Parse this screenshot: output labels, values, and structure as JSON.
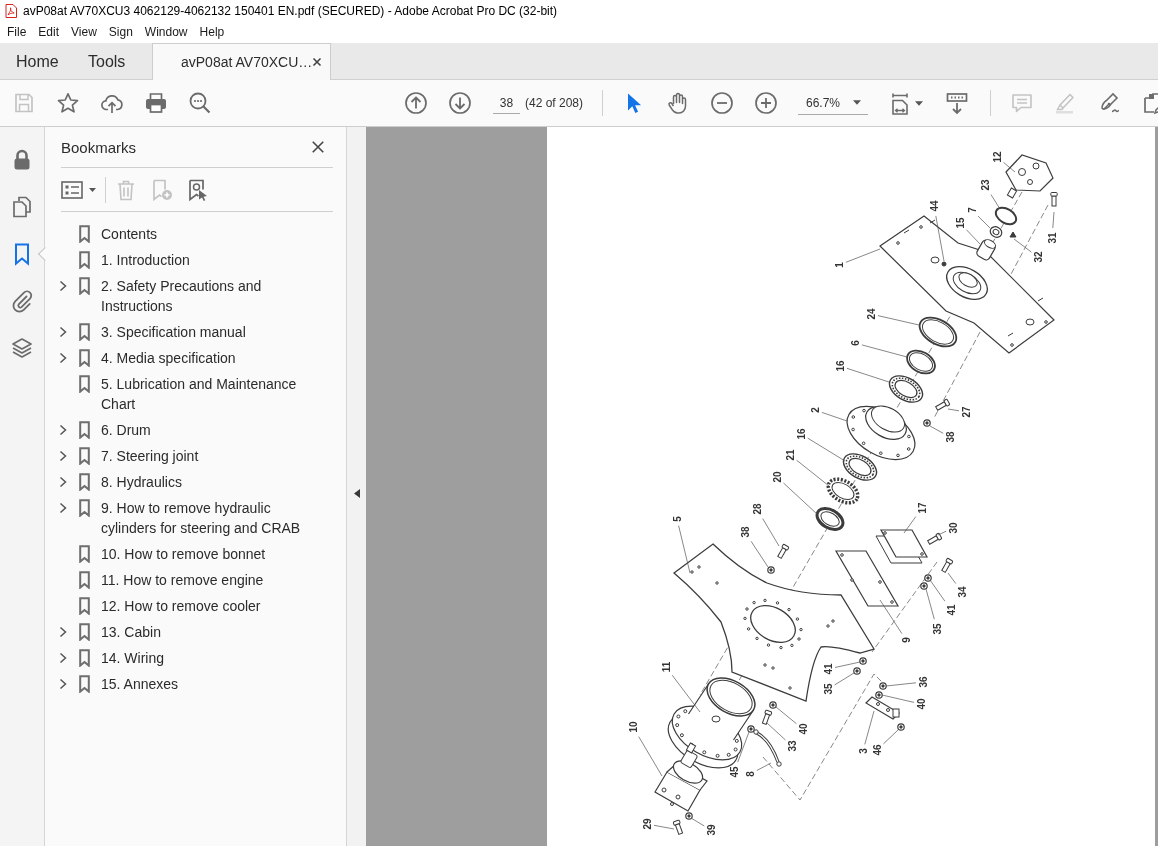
{
  "window": {
    "title": "avP08at AV70XCU3 4062129-4062132 150401 EN.pdf (SECURED) - Adobe Acrobat Pro DC (32-bit)"
  },
  "menu": [
    "File",
    "Edit",
    "View",
    "Sign",
    "Window",
    "Help"
  ],
  "tabs": [
    {
      "label": "Home",
      "selected": false,
      "kind": "view"
    },
    {
      "label": "Tools",
      "selected": false,
      "kind": "view"
    },
    {
      "label": "avP08at AV70XCU…",
      "selected": true,
      "kind": "document"
    }
  ],
  "toolbar": {
    "file_tools": [
      {
        "disabled": true
      },
      {
        "disabled": false
      },
      {
        "disabled": false
      },
      {
        "disabled": false
      },
      {
        "disabled": false
      }
    ],
    "page_field": "38",
    "page_count": "(42 of 208)",
    "modes": [
      {
        "selected": true
      },
      {
        "selected": false
      }
    ],
    "zoom": "66.7%",
    "annotate_tools": [
      {
        "disabled": true
      },
      {
        "disabled": true
      },
      {
        "disabled": false
      },
      {
        "disabled": false
      }
    ]
  },
  "nav_rail": [
    {
      "selected": false
    },
    {
      "selected": false
    },
    {
      "selected": true
    },
    {
      "selected": false
    },
    {
      "selected": false
    }
  ],
  "bookmarks": {
    "title": "Bookmarks",
    "tools": [
      {
        "disabled": false
      },
      {
        "disabled": true
      },
      {
        "disabled": true
      },
      {
        "disabled": false
      }
    ],
    "items": [
      {
        "label": "Contents",
        "kind": "leaf"
      },
      {
        "label": "1. Introduction",
        "kind": "leaf"
      },
      {
        "label": "2. Safety Precautions and Instructions",
        "kind": "group"
      },
      {
        "label": "3. Specification manual",
        "kind": "group"
      },
      {
        "label": "4. Media specification",
        "kind": "group"
      },
      {
        "label": "5. Lubrication and Maintenance Chart",
        "kind": "leaf"
      },
      {
        "label": "6. Drum",
        "kind": "group"
      },
      {
        "label": "7. Steering joint",
        "kind": "group"
      },
      {
        "label": "8. Hydraulics",
        "kind": "group"
      },
      {
        "label": "9. How to remove hydraulic cylinders for steering and CRAB",
        "kind": "group"
      },
      {
        "label": "10. How to remove bonnet",
        "kind": "leaf"
      },
      {
        "label": "11. How to remove engine",
        "kind": "leaf"
      },
      {
        "label": "12. How to remove cooler",
        "kind": "leaf"
      },
      {
        "label": "13. Cabin",
        "kind": "group"
      },
      {
        "label": "14. Wiring",
        "kind": "group"
      },
      {
        "label": "15. Annexes",
        "kind": "group"
      }
    ]
  },
  "document": {
    "callouts": [
      {
        "label": "12"
      },
      {
        "label": "23"
      },
      {
        "label": "44"
      },
      {
        "label": "7"
      },
      {
        "label": "15"
      },
      {
        "label": "1"
      },
      {
        "label": "31"
      },
      {
        "label": "32"
      },
      {
        "label": "24"
      },
      {
        "label": "6"
      },
      {
        "label": "16"
      },
      {
        "label": "27"
      },
      {
        "label": "2"
      },
      {
        "label": "38"
      },
      {
        "label": "16"
      },
      {
        "label": "21"
      },
      {
        "label": "20"
      },
      {
        "label": "5"
      },
      {
        "label": "28"
      },
      {
        "label": "38"
      },
      {
        "label": "17"
      },
      {
        "label": "30"
      },
      {
        "label": "34"
      },
      {
        "label": "41"
      },
      {
        "label": "35"
      },
      {
        "label": "9"
      },
      {
        "label": "41"
      },
      {
        "label": "35"
      },
      {
        "label": "11"
      },
      {
        "label": "36"
      },
      {
        "label": "40"
      },
      {
        "label": "40"
      },
      {
        "label": "33"
      },
      {
        "label": "10"
      },
      {
        "label": "3"
      },
      {
        "label": "46"
      },
      {
        "label": "45"
      },
      {
        "label": "8"
      },
      {
        "label": "29"
      },
      {
        "label": "39"
      }
    ]
  }
}
